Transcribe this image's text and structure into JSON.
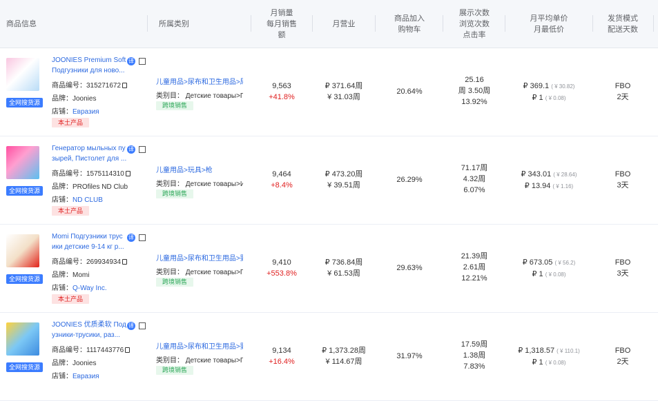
{
  "header": {
    "product_info": "商品信息",
    "category": "所属类别",
    "monthly_sales_1": "月销量",
    "monthly_sales_2": "每月销售",
    "monthly_sales_3": "额",
    "monthly_revenue": "月营业",
    "cart_1": "商品加入",
    "cart_2": "购物车",
    "views_1": "展示次数",
    "views_2": "浏览次数",
    "views_3": "点击率",
    "price_1": "月平均单价",
    "price_2": "月最低价",
    "ship_1": "发货模式",
    "ship_2": "配送天数"
  },
  "labels": {
    "sku": "商品编号：",
    "brand": "品牌：",
    "shop": "店铺：",
    "cat_label": "类别目：",
    "all_net": "全网搜货源",
    "translate": "译",
    "local": "本土产品",
    "cross": "跨境销售"
  },
  "rows": [
    {
      "title1": "JOONIES Premium Soft",
      "title2": "Подгузники для ново...",
      "sku": "315271672",
      "brand": "Joonies",
      "shop": "Евразия",
      "local": true,
      "cat_path": "儿童用品>尿布和卫生用品>尿",
      "cat_ru": "Детские товары>По",
      "sales": "9,563",
      "sales_change": "+41.8%",
      "rev1": "₽ 371.64周",
      "rev2": "¥ 31.03周",
      "cart": "20.64%",
      "v1": "25.16",
      "v2": "周 3.50周",
      "v3": "13.92%",
      "p1": "₽ 369.1",
      "p1s": "( ¥ 30.82)",
      "p2": "₽ 1",
      "p2s": "( ¥ 0.08)",
      "ship": "FBO",
      "days": "2天"
    },
    {
      "title1": "Генератор мыльных пу",
      "title2": "зырей, Пистолет для ...",
      "sku": "1575114310",
      "brand": "PROfiles ND Club",
      "shop": "ND CLUB",
      "local": true,
      "cat_path": "儿童用品>玩具>枪",
      "cat_ru": "Детские товары>Иг",
      "sales": "9,464",
      "sales_change": "+8.4%",
      "rev1": "₽ 473.20周",
      "rev2": "¥ 39.51周",
      "cart": "26.29%",
      "v1": "71.17周",
      "v2": "4.32周",
      "v3": "6.07%",
      "p1": "₽ 343.01",
      "p1s": "( ¥ 28.64)",
      "p2": "₽ 13.94",
      "p2s": "( ¥ 1.16)",
      "ship": "FBO",
      "days": "3天"
    },
    {
      "title1": "Momi Подгузники трус",
      "title2": "ики детские 9-14 кг р...",
      "sku": "269934934",
      "brand": "Momi",
      "shop": "Q-Way Inc.",
      "local": true,
      "cat_path": "儿童用品>尿布和卫生用品>婴儿",
      "cat_ru": "Детские товары>По",
      "sales": "9,410",
      "sales_change": "+553.8%",
      "rev1": "₽ 736.84周",
      "rev2": "¥ 61.53周",
      "cart": "29.63%",
      "v1": "21.39周",
      "v2": "2.61周",
      "v3": "12.21%",
      "p1": "₽ 673.05",
      "p1s": "( ¥ 56.2)",
      "p2": "₽ 1",
      "p2s": "( ¥ 0.08)",
      "ship": "FBO",
      "days": "3天"
    },
    {
      "title1": "JOONIES 优质柔软 Подг",
      "title2": "узники-трусики, раз...",
      "sku": "1117443776",
      "brand": "Joonies",
      "shop": "Евразия",
      "local": false,
      "cat_path": "儿童用品>尿布和卫生用品>婴儿",
      "cat_ru": "Детские товары>По",
      "sales": "9,134",
      "sales_change": "+16.4%",
      "rev1": "₽ 1,373.28周",
      "rev2": "¥ 114.67周",
      "cart": "31.97%",
      "v1": "17.59周",
      "v2": "1.38周",
      "v3": "7.83%",
      "p1": "₽ 1,318.57",
      "p1s": "( ¥ 110.1)",
      "p2": "₽ 1",
      "p2s": "( ¥ 0.08)",
      "ship": "FBO",
      "days": "2天"
    }
  ]
}
